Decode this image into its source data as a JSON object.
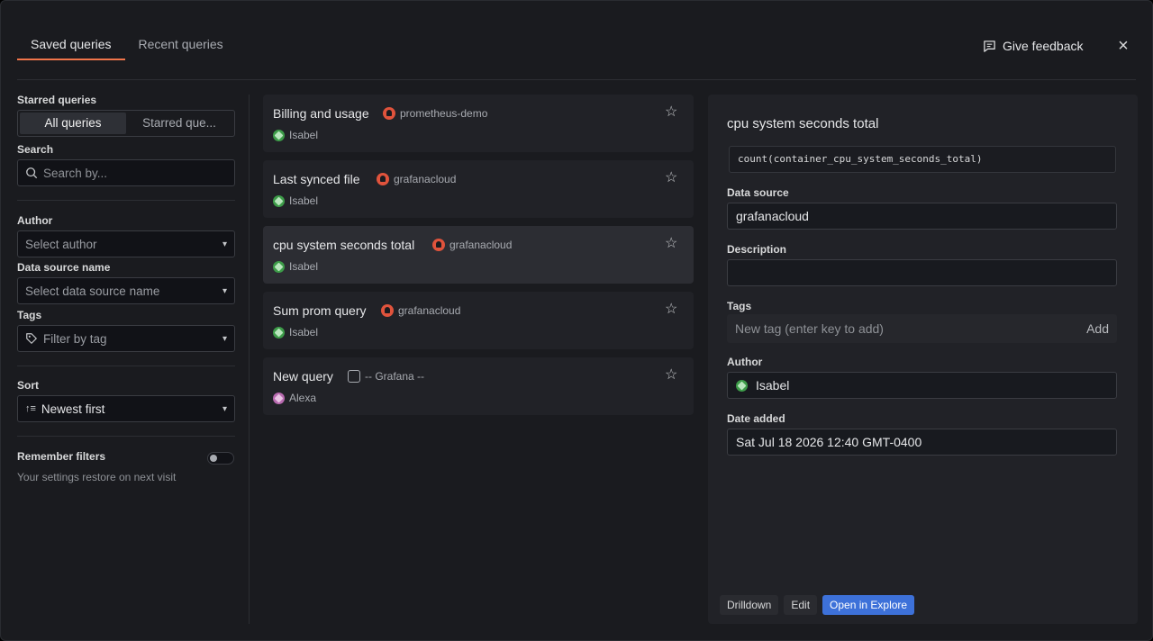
{
  "header": {
    "tabs": [
      {
        "label": "Saved queries"
      },
      {
        "label": "Recent queries"
      }
    ],
    "feedback_label": "Give feedback",
    "close_icon": "×"
  },
  "filters": {
    "starred_label": "Starred queries",
    "segments": [
      {
        "label": "All queries"
      },
      {
        "label": "Starred que..."
      }
    ],
    "search_label": "Search",
    "search_placeholder": "Search by...",
    "author_label": "Author",
    "author_value": "Select author",
    "datasource_label": "Data source name",
    "datasource_value": "Select data source name",
    "tags_label": "Tags",
    "tags_value": "Filter by tag",
    "sort_label": "Sort",
    "sort_value": "Newest first",
    "remember_label": "Remember filters",
    "remember_hint": "Your settings restore on next visit"
  },
  "queries": [
    {
      "title": "Billing and usage",
      "datasource": "prometheus-demo",
      "author": "Isabel"
    },
    {
      "title": "Last synced file",
      "datasource": "grafanacloud",
      "author": "Isabel"
    },
    {
      "title": "cpu system seconds total",
      "datasource": "grafanacloud",
      "author": "Isabel"
    },
    {
      "title": "Sum prom query",
      "datasource": "grafanacloud",
      "author": "Isabel"
    },
    {
      "title": "New query",
      "datasource": "-- Grafana --",
      "author": "Alexa"
    }
  ],
  "detail": {
    "title": "cpu system seconds total",
    "query": "count(container_cpu_system_seconds_total)",
    "datasource_label": "Data source",
    "datasource_value": "grafanacloud",
    "description_label": "Description",
    "description_value": "",
    "tags_label": "Tags",
    "tags_placeholder": "New tag (enter key to add)",
    "tags_add": "Add",
    "author_label": "Author",
    "author_value": "Isabel",
    "date_label": "Date added",
    "date_value": "Sat Jul 18 2026 12:40 GMT-0400",
    "buttons": {
      "drilldown": "Drilldown",
      "edit": "Edit",
      "explore": "Open in Explore"
    }
  },
  "colors": {
    "accent": "#f0754a",
    "primary_button": "#3d71d9",
    "datasource_icon": "#e0533c"
  }
}
